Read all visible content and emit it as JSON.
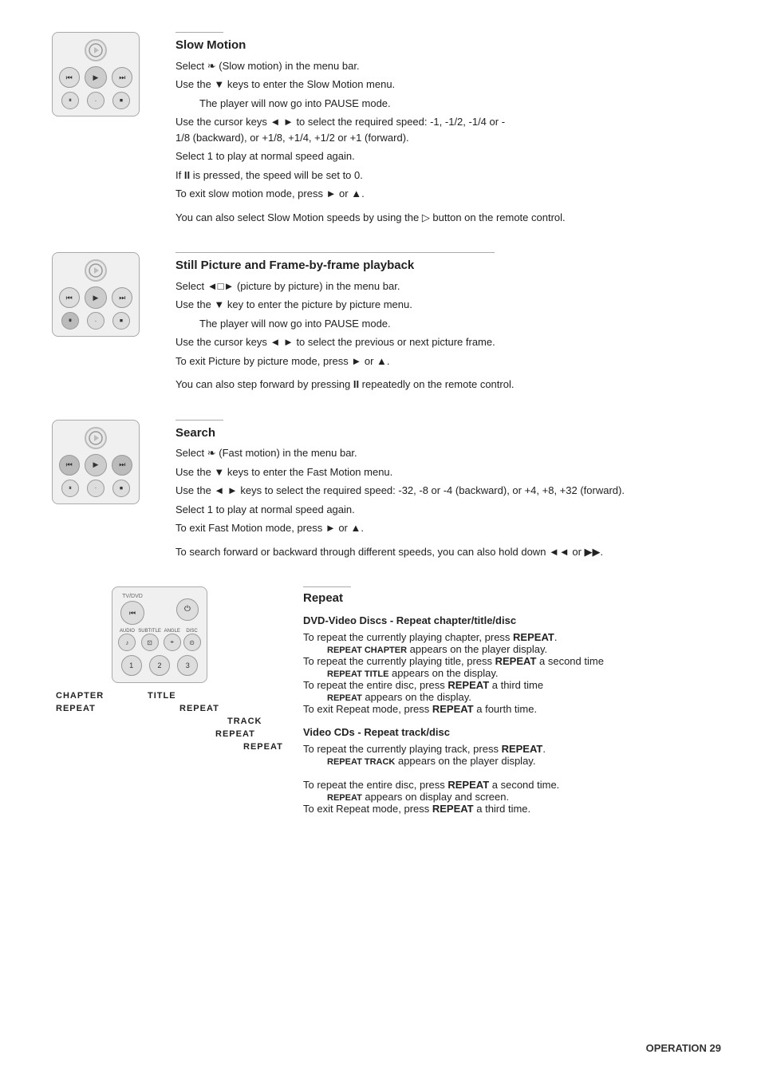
{
  "sections": {
    "slow_motion": {
      "title": "Slow Motion",
      "divider": true,
      "instructions": [
        "Select ❧ (Slow motion) in the menu bar.",
        "Use the ▼ keys to enter the Slow Motion menu.",
        "The player will now go into PAUSE mode.",
        "Use the cursor keys ◄ ► to select the required speed: -1, -1/2, -1/4 or -1/8 (backward), or +1/8, +1/4, +1/2 or +1 (forward).",
        "Select 1 to play at normal speed again.",
        "If II is pressed, the speed will be set to 0.",
        "To exit slow motion mode, press ► or ▲."
      ],
      "note": "You can also select Slow Motion speeds by using the ▷ button on the remote control."
    },
    "still_picture": {
      "title": "Still Picture and Frame-by-frame playback",
      "divider": true,
      "instructions": [
        "Select ◄□► (picture by picture) in the menu bar.",
        "Use the ▼ key to enter the picture by picture menu.",
        "The player will now go into PAUSE mode.",
        "Use the cursor keys ◄ ► to select the previous or next picture frame.",
        "To exit Picture by picture mode, press ► or ▲."
      ],
      "note": "You can also step forward by pressing II repeatedly on the remote control."
    },
    "search": {
      "title": "Search",
      "divider": true,
      "instructions": [
        "Select ❧ (Fast motion) in the menu bar.",
        "Use the ▼ keys to enter the Fast Motion menu.",
        "Use the ◄ ► keys to select the required speed: -32, -8 or -4 (backward), or +4, +8, +32 (forward).",
        "Select 1 to play at normal speed again.",
        "To exit Fast Motion mode, press ► or ▲."
      ],
      "note": "To search forward or backward through different speeds, you can also hold down ◄◄ or ►►."
    },
    "repeat": {
      "title": "Repeat",
      "divider": true,
      "dvd_subtitle": "DVD-Video Discs - Repeat chapter/title/disc",
      "dvd_instructions": [
        {
          "text": "To repeat the currently playing chapter, press ",
          "bold": "REPEAT",
          "after": "."
        },
        {
          "indent": true,
          "small_caps": "REPEAT CHAPTER",
          "after": " appears on the player display."
        },
        {
          "text": "To repeat the currently playing title, press ",
          "bold": "REPEAT",
          "after": " a second time"
        },
        {
          "indent": true,
          "small_caps": "REPEAT TITLE",
          "after": " appears on the display."
        },
        {
          "text": "To repeat the entire disc, press ",
          "bold": "REPEAT",
          "after": " a third time"
        },
        {
          "indent": true,
          "small_caps": "REPEAT",
          "after": " appears on the display."
        },
        {
          "text": "To exit Repeat mode, press ",
          "bold": "REPEAT",
          "after": " a fourth time."
        }
      ],
      "vcd_subtitle": "Video CDs - Repeat track/disc",
      "vcd_instructions": [
        {
          "text": "To repeat the currently playing track, press ",
          "bold": "REPEAT",
          "after": "."
        },
        {
          "indent": true,
          "small_caps": "REPEAT TRACK",
          "after": " appears on the player display."
        },
        {
          "text": ""
        },
        {
          "text": "To repeat the entire disc, press ",
          "bold": "REPEAT",
          "after": " a second time."
        },
        {
          "indent": true,
          "small_caps": "REPEAT",
          "after": " appears on display and screen."
        },
        {
          "text": "To exit Repeat mode, press ",
          "bold": "REPEAT",
          "after": " a third time."
        }
      ],
      "display_labels": {
        "chapter": "CHAPTER",
        "chapter_repeat": "REPEAT",
        "title": "TITLE",
        "title_repeat": "REPEAT",
        "track": "TRACK",
        "track_repeat": "REPEAT",
        "disc_repeat": "REPEAT"
      }
    }
  },
  "footer": {
    "text": "OPERATION 29"
  }
}
